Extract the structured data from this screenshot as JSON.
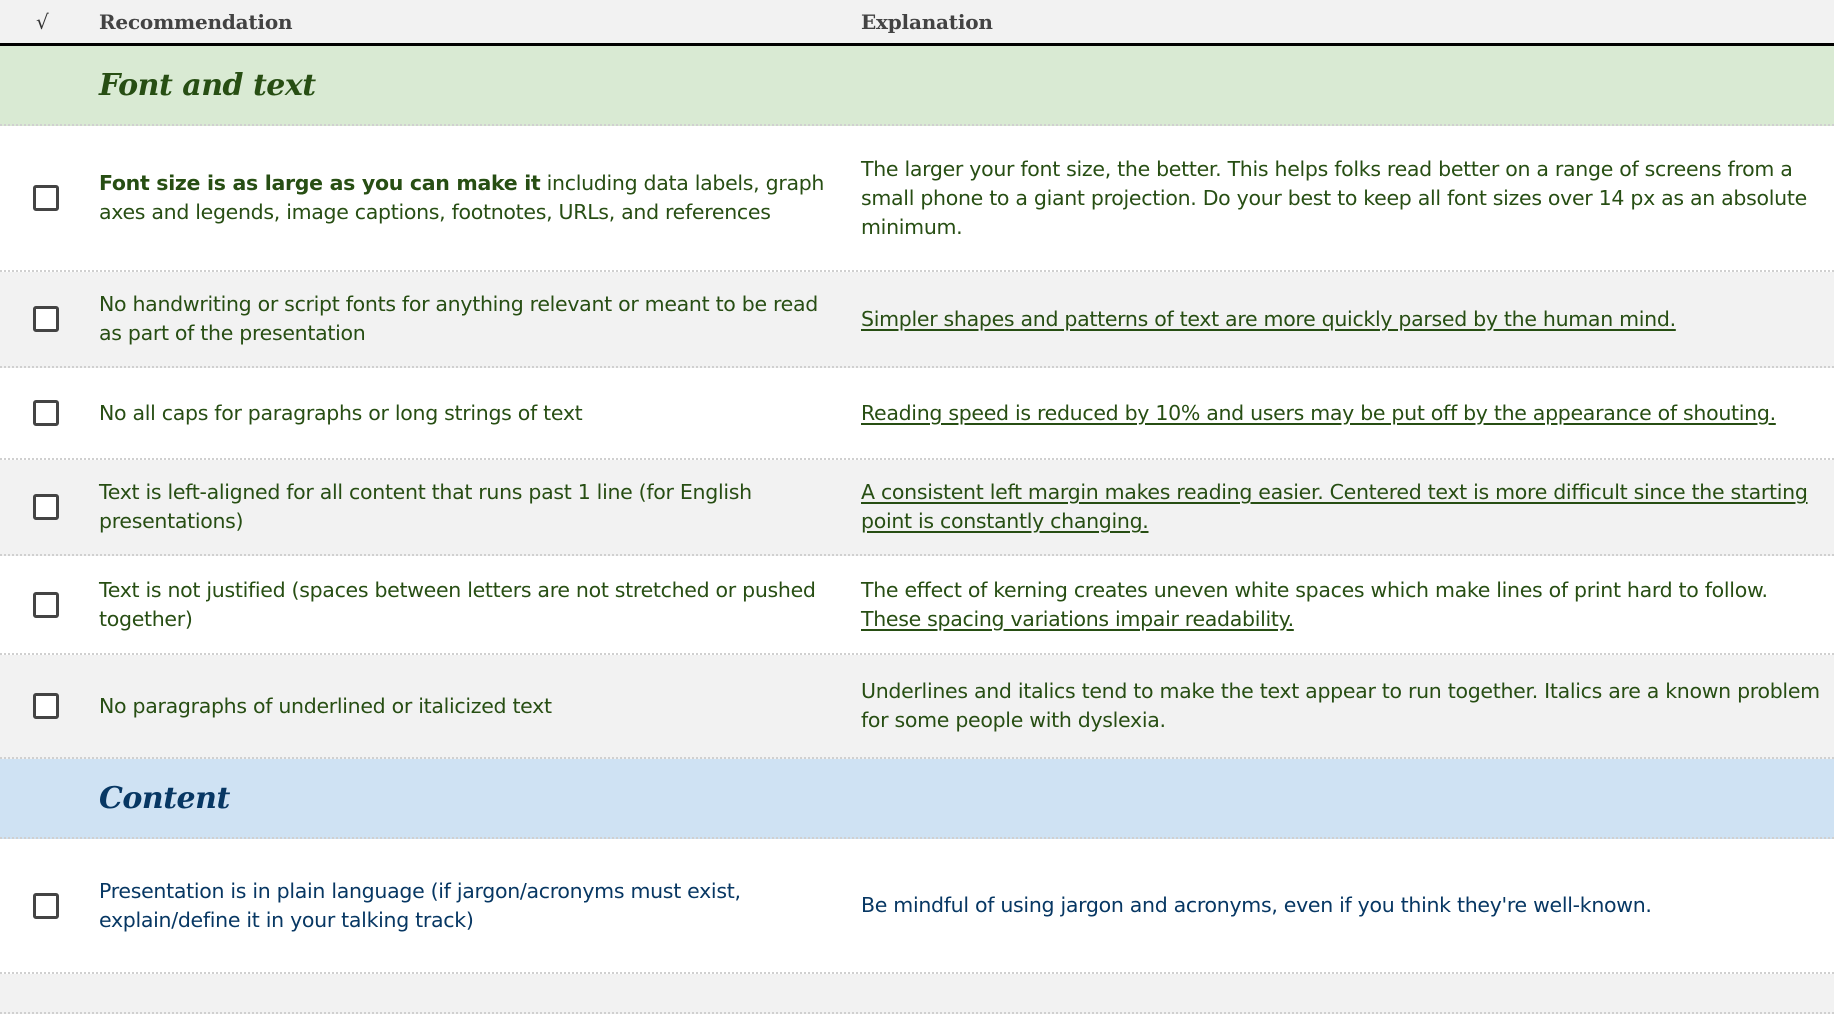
{
  "header": {
    "check_symbol": "√",
    "recommendation": "Recommendation",
    "explanation": "Explanation"
  },
  "colors": {
    "green_band": "#d9ead3",
    "green_text": "#274e13",
    "blue_band": "#cfe2f3",
    "blue_text": "#073763",
    "alt_row": "#f2f2f2"
  },
  "sections": [
    {
      "title": "Font and text",
      "rows": [
        {
          "checked": false,
          "rec_bold": "Font size is as large as you can make it",
          "rec": " including data labels, graph axes and legends, image captions, footnotes, URLs, and references",
          "exp": "The larger your font size, the better. This helps folks read better on a range of screens from a small phone to a giant projection. Do your best to keep all font sizes over 14 px as an absolute minimum.",
          "exp_link": ""
        },
        {
          "checked": false,
          "rec": "No handwriting or script fonts for anything relevant or meant to be read as part of the presentation",
          "exp": "",
          "exp_link": "Simpler shapes and patterns of text are more quickly parsed by the human mind."
        },
        {
          "checked": false,
          "rec": "No all caps for paragraphs or long strings of text",
          "exp": "",
          "exp_link": "Reading speed is reduced by 10% and users may be put off by the appearance of shouting."
        },
        {
          "checked": false,
          "rec": "Text is left-aligned for all content that runs past 1 line (for English presentations)",
          "exp": "",
          "exp_link": "A consistent left margin makes reading easier. Centered text is more difficult since the starting point is constantly changing."
        },
        {
          "checked": false,
          "rec": "Text is not justified (spaces between letters are not stretched or pushed together)",
          "exp": "The effect of kerning creates uneven white spaces which make lines of print hard to follow. ",
          "exp_link": "These spacing variations impair readability."
        },
        {
          "checked": false,
          "rec": "No paragraphs of underlined or italicized text",
          "exp": "Underlines and italics tend to make the text appear to run together. Italics are a known problem for some people with dyslexia.",
          "exp_link": ""
        }
      ]
    },
    {
      "title": "Content",
      "rows": [
        {
          "checked": false,
          "rec": "Presentation is in plain language (if jargon/acronyms must exist, explain/define it in your talking track)",
          "exp": "Be mindful of using jargon and acronyms, even if you think they're well-known.",
          "exp_link": ""
        }
      ]
    }
  ]
}
